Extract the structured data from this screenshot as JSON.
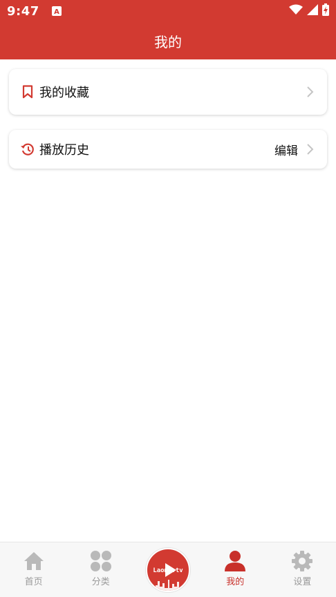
{
  "status_bar": {
    "time": "9:47"
  },
  "header": {
    "title": "我的"
  },
  "favorites": {
    "label": "我的收藏"
  },
  "history": {
    "label": "播放历史",
    "edit_label": "编辑"
  },
  "tabs": [
    {
      "label": "首页",
      "icon": "home-icon",
      "active": false
    },
    {
      "label": "分类",
      "icon": "category-icon",
      "active": false
    },
    {
      "label": "",
      "icon": "center-play-logo",
      "logo_text": "Laomi.tv",
      "active": false
    },
    {
      "label": "我的",
      "icon": "profile-icon",
      "active": true
    },
    {
      "label": "设置",
      "icon": "settings-icon",
      "active": false
    }
  ],
  "colors": {
    "brand": "#d23a31",
    "active_tab": "#c8302a",
    "inactive_tab": "#9a9a9a"
  }
}
